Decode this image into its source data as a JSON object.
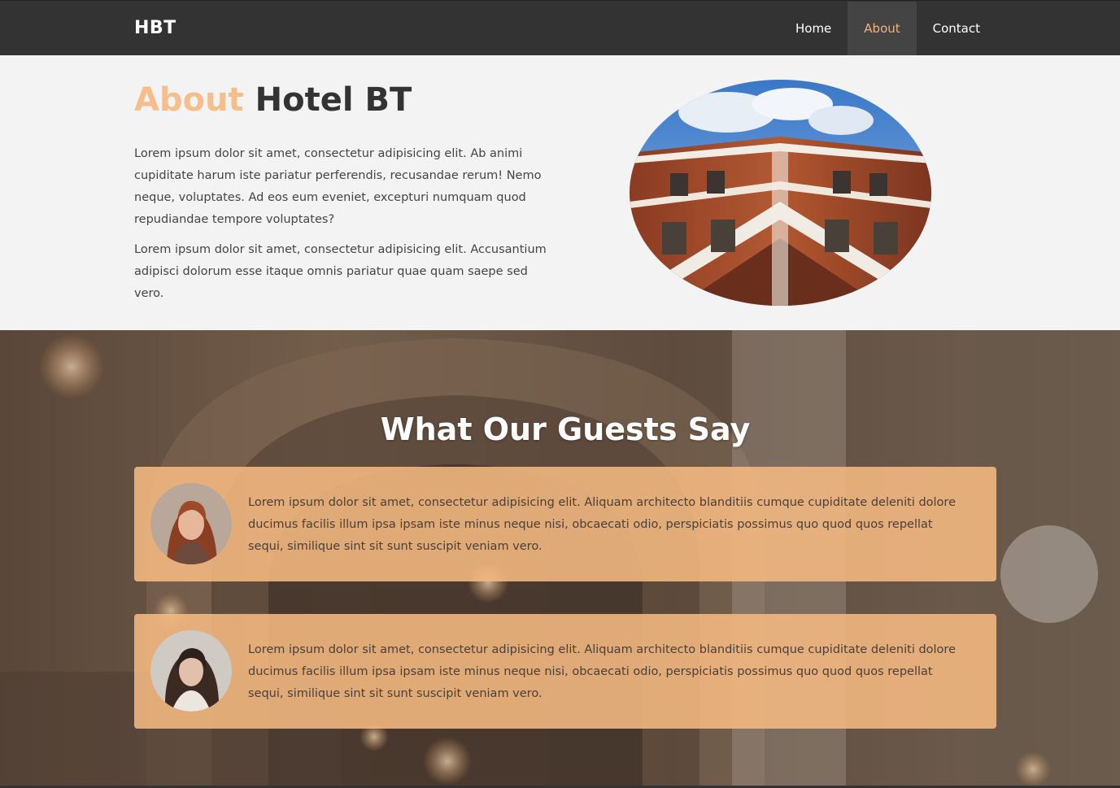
{
  "nav": {
    "brand": "HBT",
    "links": [
      "Home",
      "About",
      "Contact"
    ],
    "active": "About"
  },
  "about": {
    "title_accent": "About",
    "title_rest": "Hotel BT",
    "paragraphs": [
      "Lorem ipsum dolor sit amet, consectetur adipisicing elit. Ab animi cupiditate harum iste pariatur perferendis, recusandae rerum! Nemo neque, voluptates. Ad eos eum eveniet, excepturi numquam quod repudiandae tempore voluptates?",
      "Lorem ipsum dolor sit amet, consectetur adipisicing elit. Accusantium adipisci dolorum esse itaque omnis pariatur quae quam saepe sed vero."
    ]
  },
  "testimonials": {
    "title": "What Our Guests Say",
    "items": [
      {
        "text": "Lorem ipsum dolor sit amet, consectetur adipisicing elit. Aliquam architecto blanditiis cumque cupiditate deleniti dolore ducimus facilis illum ipsa ipsam iste minus neque nisi, obcaecati odio, perspiciatis possimus quo quod quos repellat sequi, similique sint sit sunt suscipit veniam vero."
      },
      {
        "text": "Lorem ipsum dolor sit amet, consectetur adipisicing elit. Aliquam architecto blanditiis cumque cupiditate deleniti dolore ducimus facilis illum ipsa ipsam iste minus neque nisi, obcaecati odio, perspiciatis possimus quo quod quos repellat sequi, similique sint sit sunt suscipit veniam vero."
      }
    ]
  },
  "colors": {
    "nav_bg": "#333333",
    "accent": "#f5be8a",
    "about_bg": "#f3f3f3",
    "card_bg": "#f5b982"
  }
}
